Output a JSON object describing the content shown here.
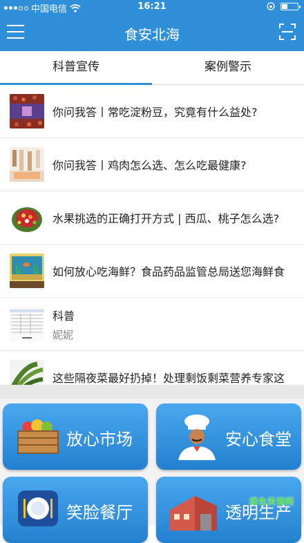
{
  "status_bar": {
    "carrier": "中国电信",
    "time": "16:21"
  },
  "nav": {
    "title": "食安北海"
  },
  "tabs": [
    {
      "label": "科普宣传",
      "active": true
    },
    {
      "label": "案例警示",
      "active": false
    }
  ],
  "articles": [
    {
      "title": "你问我答丨常吃淀粉豆，究竟有什么益处?",
      "subtitle": "",
      "thumb_icon": "beans-thumbnail"
    },
    {
      "title": "你问我答丨鸡肉怎么选、怎么吃最健康?",
      "subtitle": "",
      "thumb_icon": "chicken-thumbnail"
    },
    {
      "title": "水果挑选的正确打开方式 | 西瓜、桃子怎么选?",
      "subtitle": "",
      "thumb_icon": "fruit-cake-thumbnail"
    },
    {
      "title": "如何放心吃海鲜？食品药品监管总局送您海鲜食",
      "subtitle": "",
      "thumb_icon": "aquarium-thumbnail"
    },
    {
      "title": "科普",
      "subtitle": "妮妮",
      "thumb_icon": "document-thumbnail"
    },
    {
      "title": "这些隔夜菜最好扔掉！处理剩饭剩菜营养专家这",
      "subtitle": "",
      "thumb_icon": "vegetable-thumbnail"
    }
  ],
  "tiles": [
    {
      "label": "放心市场",
      "icon": "market-basket-icon"
    },
    {
      "label": "安心食堂",
      "icon": "chef-icon"
    },
    {
      "label": "笑脸餐厅",
      "icon": "dining-plate-icon"
    },
    {
      "label": "透明生产",
      "icon": "factory-icon"
    }
  ],
  "watermark": "绿色资源网",
  "colors": {
    "brand_blue": "#2f8fd8",
    "tile_blue": "#3a98e4"
  }
}
